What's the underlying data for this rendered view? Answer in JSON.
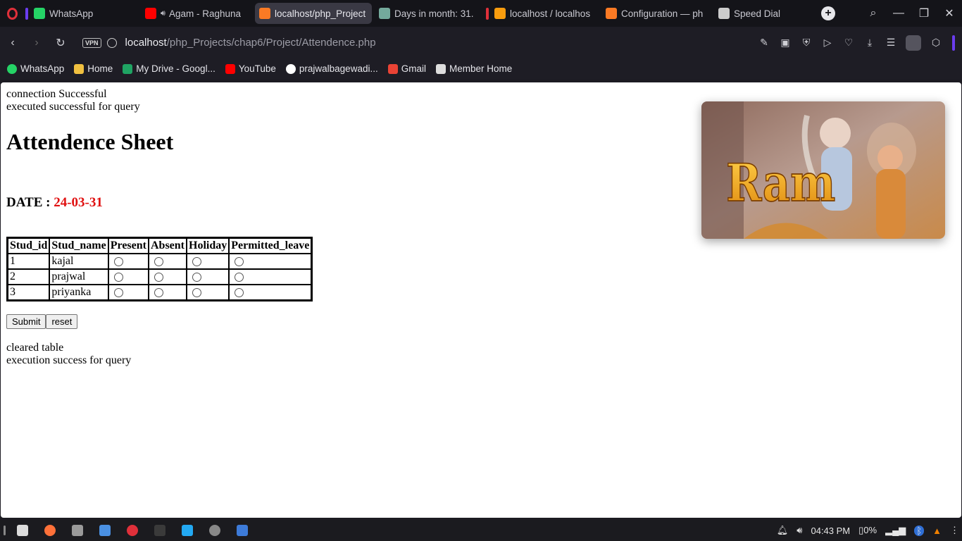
{
  "browser": {
    "tabs": [
      {
        "title": "WhatsApp",
        "icon": "whatsapp-icon",
        "color": "#25d366",
        "accent": "#6b3df0"
      },
      {
        "title": "Agam - Raghuna",
        "icon": "youtube-icon",
        "color": "#ff0000",
        "audio": true
      },
      {
        "title": "localhost/php_Project",
        "icon": "xampp-icon",
        "color": "#fb7a24",
        "active": true
      },
      {
        "title": "Days in month: 31.",
        "icon": "chatgpt-icon",
        "color": "#74aa9c"
      },
      {
        "title": "localhost / localhos",
        "icon": "phpmyadmin-icon",
        "color": "#f89c0e",
        "accent": "#e0303a"
      },
      {
        "title": "Configuration — ph",
        "icon": "xampp-icon",
        "color": "#fb7a24"
      },
      {
        "title": "Speed Dial",
        "icon": "speed-dial-icon",
        "color": "#cccccc"
      }
    ],
    "address": {
      "vpn_label": "VPN",
      "url_host": "localhost",
      "url_path": "/php_Projects/chap6/Project/Attendence.php"
    },
    "bookmarks": [
      {
        "label": "WhatsApp",
        "icon": "whatsapp-icon",
        "color": "#25d366"
      },
      {
        "label": "Home",
        "icon": "home-icon",
        "color": "#f0c040"
      },
      {
        "label": "My Drive - Googl...",
        "icon": "google-drive-icon",
        "color": "#1fa463"
      },
      {
        "label": "YouTube",
        "icon": "youtube-icon",
        "color": "#ff0000"
      },
      {
        "label": "prajwalbagewadi...",
        "icon": "github-icon",
        "color": "#ffffff"
      },
      {
        "label": "Gmail",
        "icon": "gmail-icon",
        "color": "#ea4335"
      },
      {
        "label": "Member Home",
        "icon": "page-icon",
        "color": "#dddddd"
      }
    ]
  },
  "page": {
    "status_lines": [
      "connection Successful",
      "executed successful for query"
    ],
    "title": "Attendence Sheet",
    "date_label": "DATE : ",
    "date_value": "24-03-31",
    "date_color": "#e01010",
    "table": {
      "headers": [
        "Stud_id",
        "Stud_name",
        "Present",
        "Absent",
        "Holiday",
        "Permitted_leave"
      ],
      "rows": [
        {
          "id": "1",
          "name": "kajal"
        },
        {
          "id": "2",
          "name": "prajwal"
        },
        {
          "id": "3",
          "name": "priyanka"
        }
      ]
    },
    "submit_label": "Submit",
    "reset_label": "reset",
    "footer_lines": [
      "cleared table",
      "execution success for query"
    ],
    "image_text": "Ram"
  },
  "taskbar": {
    "apps": [
      "zorin-menu-icon",
      "firefox-icon",
      "files-icon",
      "screenshot-icon",
      "opera-icon",
      "terminal-icon",
      "vscode-icon",
      "clock-icon",
      "app-icon"
    ],
    "time": "04:43 PM",
    "battery": "0%"
  }
}
